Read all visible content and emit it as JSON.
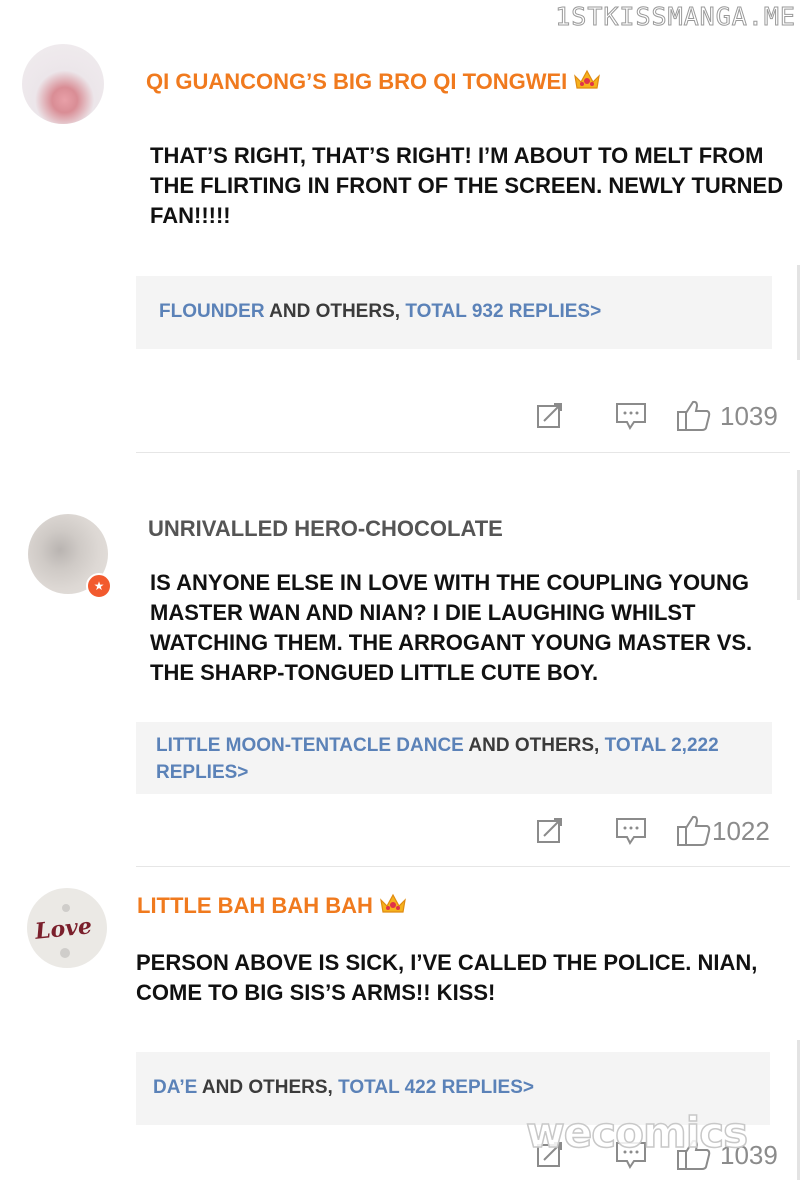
{
  "watermarks": {
    "top": "1STKISSMANGA.ME",
    "bottom": "wecomics"
  },
  "comments": [
    {
      "avatar_icon": "avatar-photo",
      "username": "QI GUANCONG’S BIG BRO QI TONGWEI",
      "username_color": "#f07a1e",
      "badge_icon": "crown-icon",
      "text": "THAT’S RIGHT, THAT’S RIGHT! I’M ABOUT TO MELT FROM THE FLIRTING IN FRONT OF THE SCREEN. NEWLY TURNED FAN!!!!!",
      "replies": {
        "names": "FLOUNDER",
        "middle": " AND OTHERS, ",
        "total": "TOTAL 932 REPLIES>"
      },
      "likes": "1039"
    },
    {
      "avatar_icon": "avatar-photo",
      "avatar_badge_icon": "vip-star-icon",
      "username": "UNRIVALLED HERO-CHOCOLATE",
      "username_color": "#555555",
      "text": "IS ANYONE ELSE IN LOVE WITH THE COUPLING YOUNG MASTER WAN AND NIAN? I DIE LAUGHING WHILST WATCHING THEM. THE ARROGANT YOUNG MASTER VS. THE SHARP-TONGUED LITTLE CUTE BOY.",
      "replies": {
        "names": "LITTLE MOON-TENTACLE DANCE",
        "middle": " AND OTHERS, ",
        "total": "TOTAL 2,222 REPLIES>"
      },
      "likes": "1022"
    },
    {
      "avatar_icon": "avatar-love",
      "avatar_text": "Love",
      "username": "LITTLE BAH BAH BAH",
      "username_color": "#f07a1e",
      "badge_icon": "crown-icon",
      "text": "PERSON ABOVE IS SICK, I’VE CALLED THE POLICE. NIAN, COME TO BIG SIS’S ARMS!! KISS!",
      "replies": {
        "names": "DA’E",
        "middle": " AND OTHERS, ",
        "total": "TOTAL 422 REPLIES>"
      },
      "likes": "1039"
    }
  ],
  "action_icons": [
    "share-icon",
    "comment-icon",
    "thumbs-up-icon"
  ],
  "colors": {
    "link": "#5b82b8",
    "reply_bg": "#f4f4f4",
    "icon_gray": "#8b8b8b"
  }
}
